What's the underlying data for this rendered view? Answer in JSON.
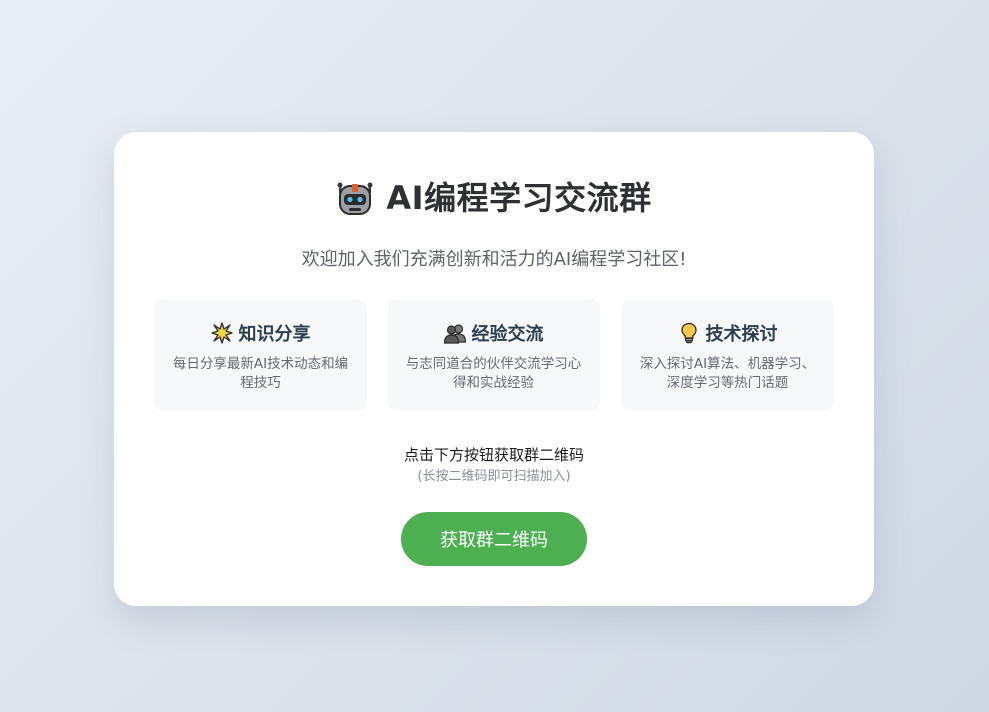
{
  "header": {
    "icon": "robot-icon",
    "title": "AI编程学习交流群",
    "subtitle": "欢迎加入我们充满创新和活力的AI编程学习社区!"
  },
  "features": [
    {
      "icon": "sparkle-icon",
      "title": "知识分享",
      "desc": "每日分享最新AI技术动态和编程技巧"
    },
    {
      "icon": "people-icon",
      "title": "经验交流",
      "desc": "与志同道合的伙伴交流学习心得和实战经验"
    },
    {
      "icon": "lightbulb-icon",
      "title": "技术探讨",
      "desc": "深入探讨AI算法、机器学习、深度学习等热门话题"
    }
  ],
  "cta": {
    "prompt": "点击下方按钮获取群二维码",
    "hint": "(长按二维码即可扫描加入)",
    "button_label": "获取群二维码"
  },
  "colors": {
    "accent_green": "#4caf50",
    "title_text": "#2f3033",
    "feature_title": "#2c3e50",
    "card_bg": "#ffffff",
    "feature_bg": "#f6f8fa"
  }
}
